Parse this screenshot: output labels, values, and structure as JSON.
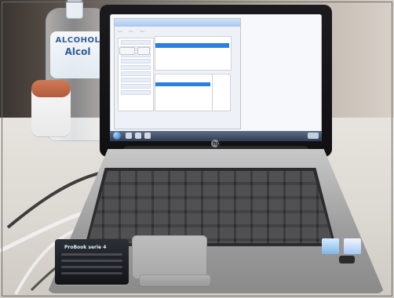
{
  "photo": {
    "bottle_label": {
      "line1": "ALCOHOL",
      "line2": "Alcol"
    },
    "laptop": {
      "brand_mark": "hp"
    },
    "sticker": {
      "title": "ProBook serie 4"
    }
  }
}
